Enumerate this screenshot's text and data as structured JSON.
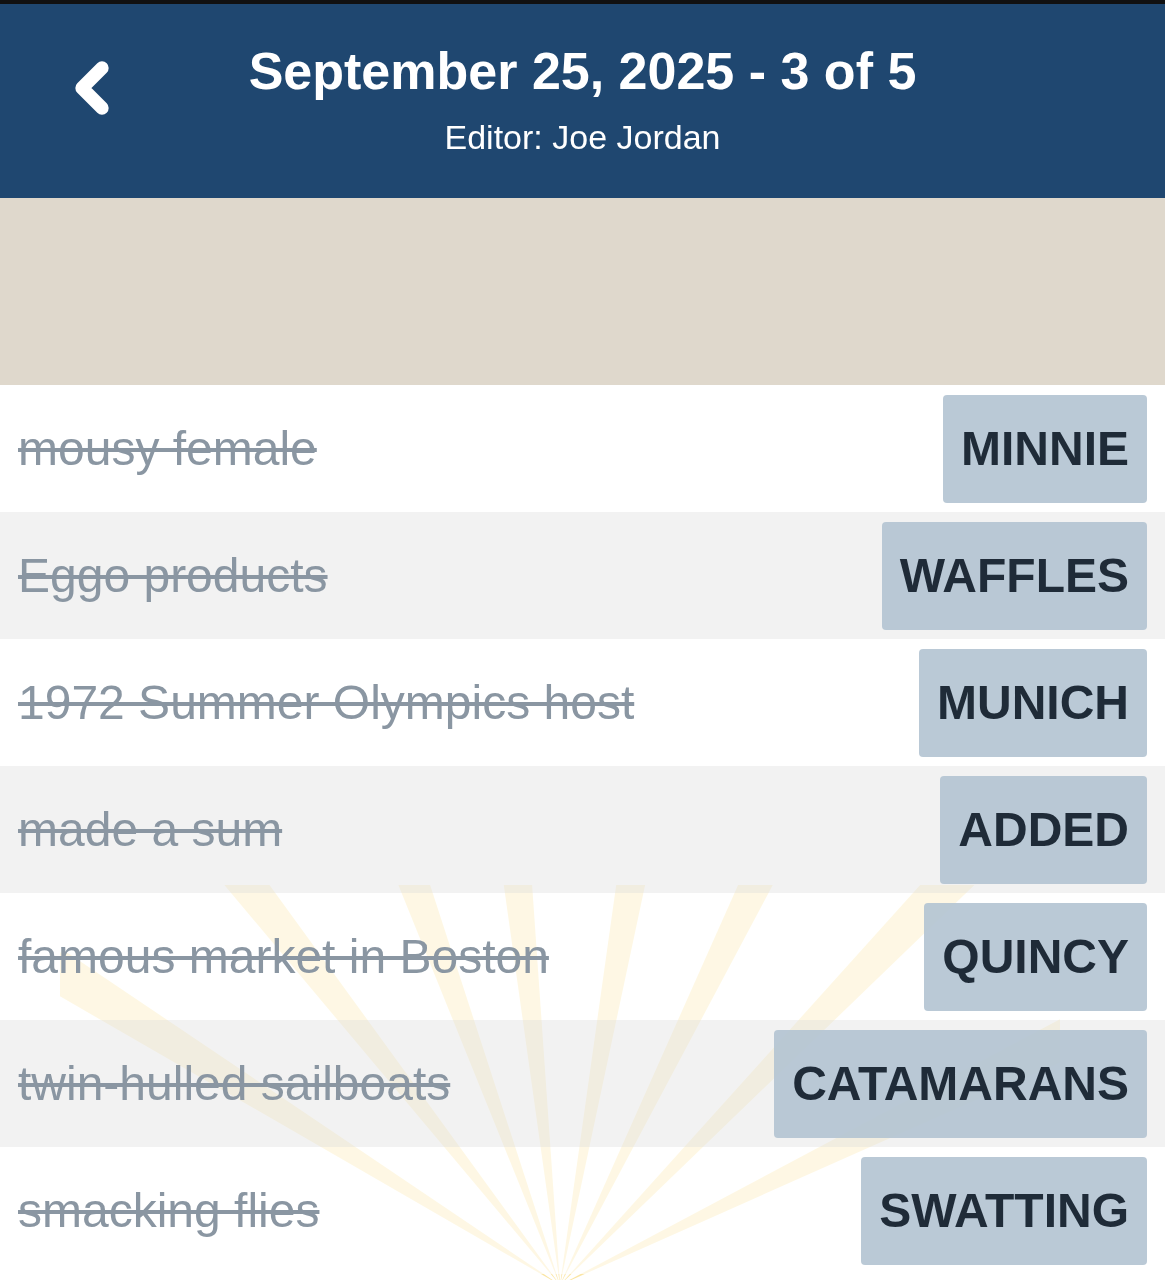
{
  "header": {
    "title": "September 25, 2025 - 3 of 5",
    "subtitle": "Editor: Joe Jordan"
  },
  "clues": [
    {
      "clue": "mousy female",
      "answer": "MINNIE",
      "solved": true
    },
    {
      "clue": "Eggo products",
      "answer": "WAFFLES",
      "solved": true
    },
    {
      "clue": "1972 Summer Olympics host",
      "answer": "MUNICH",
      "solved": true
    },
    {
      "clue": "made a sum",
      "answer": "ADDED",
      "solved": true
    },
    {
      "clue": "famous market in Boston",
      "answer": "QUINCY",
      "solved": true
    },
    {
      "clue": "twin-hulled sailboats",
      "answer": "CATAMARANS",
      "solved": true
    },
    {
      "clue": "smacking flies",
      "answer": "SWATTING",
      "solved": true
    }
  ]
}
